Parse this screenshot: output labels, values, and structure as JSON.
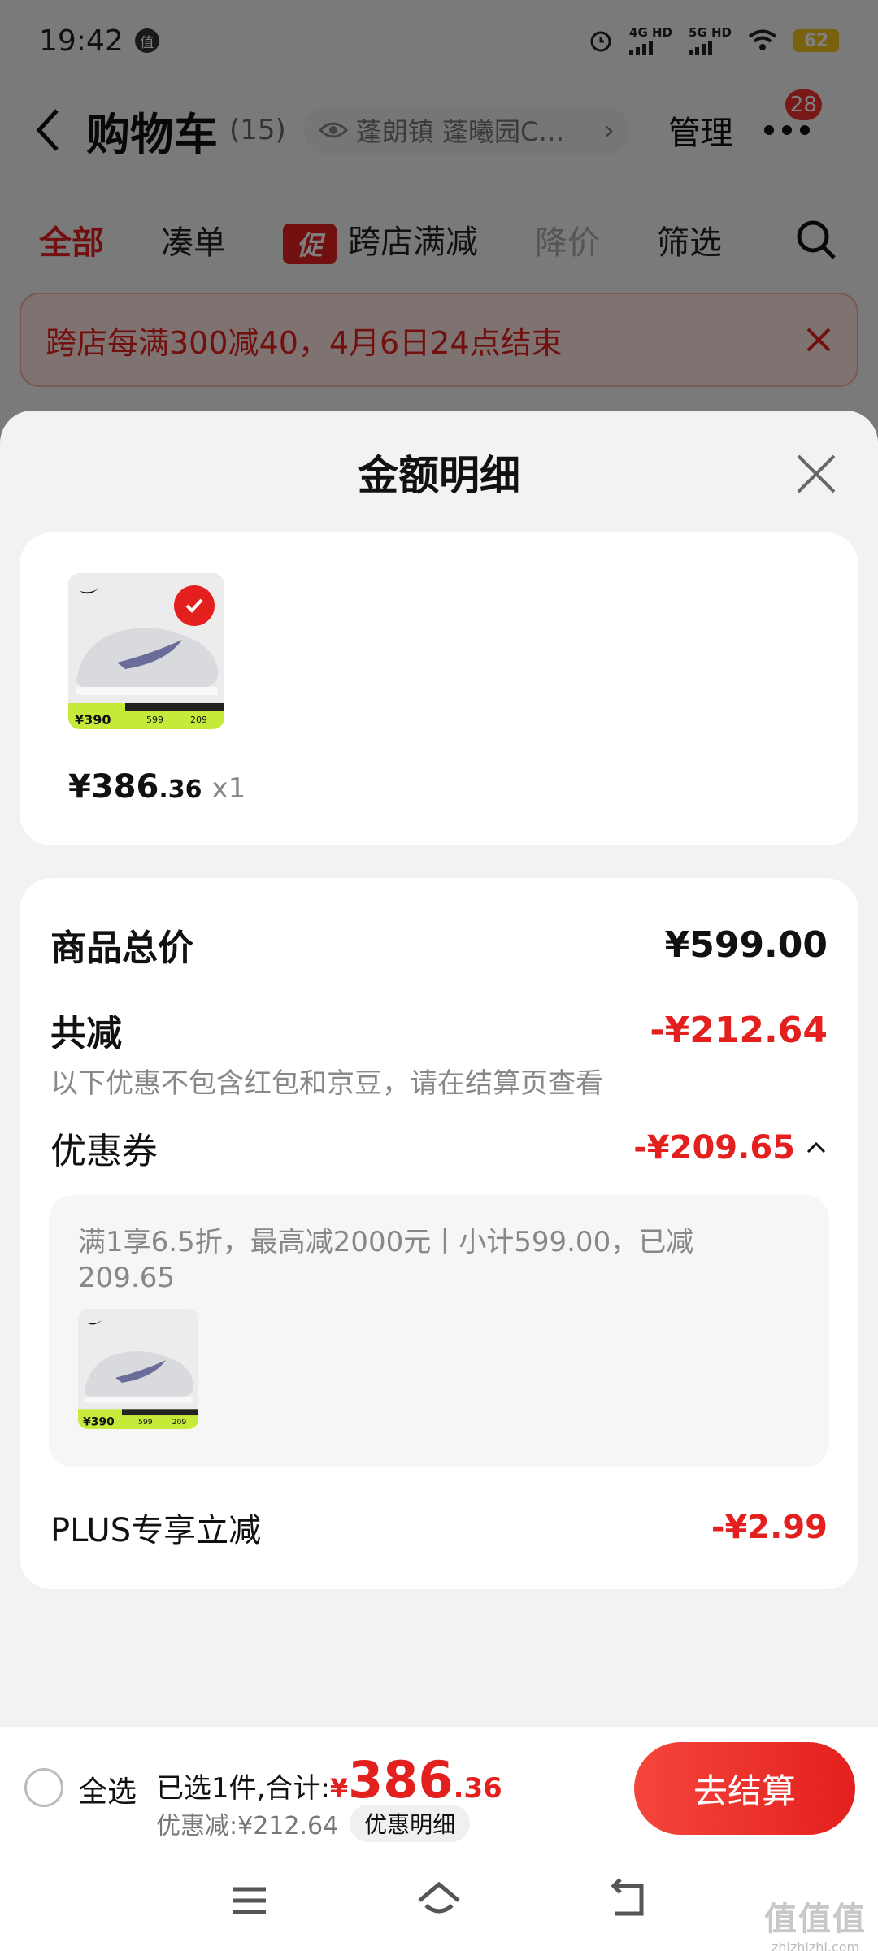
{
  "status_bar": {
    "time": "19:42",
    "badge": "值",
    "net1": "4G HD",
    "net2": "5G HD",
    "battery": "62"
  },
  "header": {
    "title": "购物车",
    "count": "(15)",
    "address": "蓬朗镇 蓬曦园C…",
    "manage": "管理",
    "more_badge": "28"
  },
  "tabs": [
    {
      "label": "全部"
    },
    {
      "label": "凑单"
    },
    {
      "label": "跨店满减",
      "tag": "促"
    },
    {
      "label": "降价"
    },
    {
      "label": "筛选"
    }
  ],
  "promo_banner": {
    "text": "跨店每满300减40，4月6日24点结束"
  },
  "sheet": {
    "title": "金额明细",
    "product": {
      "price_int": "¥386",
      "price_dec": ".36",
      "qty": "x1",
      "thumb_price": "¥390",
      "thumb_a": "599",
      "thumb_b": "209"
    },
    "total_label": "商品总价",
    "total_value": "¥599.00",
    "reduce_label": "共减",
    "reduce_value": "-¥212.64",
    "reduce_note": "以下优惠不包含红包和京豆，请在结算页查看",
    "coupon_label": "优惠券",
    "coupon_value": "-¥209.65",
    "coupon_desc": "满1享6.5折，最高减2000元丨小计599.00，已减209.65",
    "plus_label": "PLUS专享立减",
    "plus_value": "-¥2.99"
  },
  "checkout": {
    "select_all": "全选",
    "selected_text": "已选1件,合计:",
    "total_cur": "¥",
    "total_int": "386",
    "total_dec": ".36",
    "discount_text": "优惠减:¥212.64",
    "detail_chip": "优惠明细",
    "checkout_btn": "去结算"
  },
  "watermark": {
    "logo": "值值值",
    "url": "zhizhizhi.com"
  },
  "colors": {
    "accent": "#e3201e",
    "promo_bg": "#fde6e3"
  }
}
